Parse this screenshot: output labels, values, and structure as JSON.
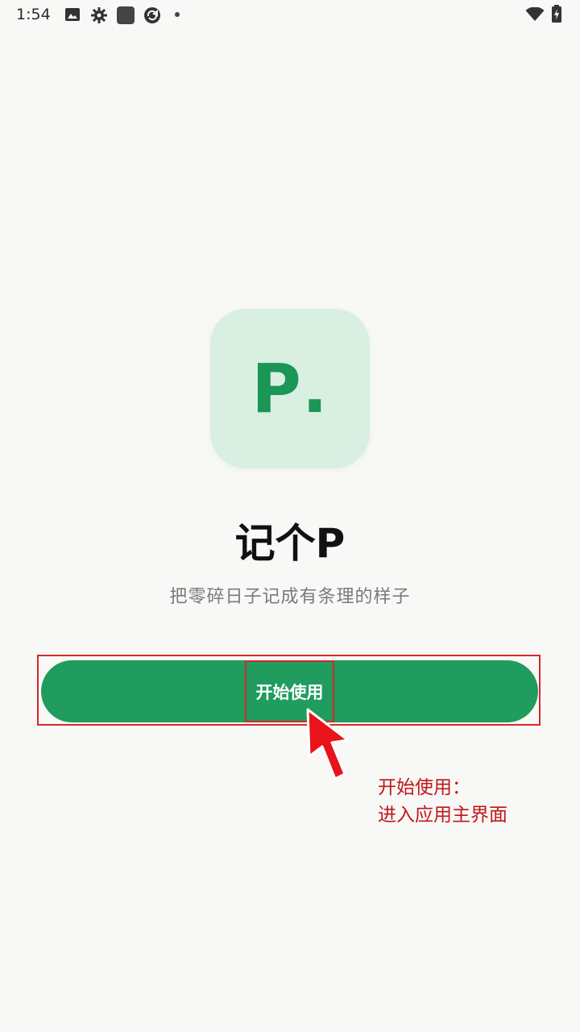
{
  "status_bar": {
    "time": "1:54",
    "icons": [
      "image-icon",
      "gear-icon",
      "app-square-icon",
      "sync-icon",
      "dot-icon",
      "wifi-icon",
      "battery-charging-icon"
    ]
  },
  "logo": {
    "letter": "P",
    "dot": ".",
    "background": "#d8efe2",
    "color": "#1a9657"
  },
  "app": {
    "title": "记个P",
    "tagline": "把零碎日子记成有条理的样子"
  },
  "start_button": {
    "label": "开始使用",
    "color": "#1f9c5e"
  },
  "annotation": {
    "line1": "开始使用：",
    "line2": "进入应用主界面",
    "color": "#c0171a"
  }
}
